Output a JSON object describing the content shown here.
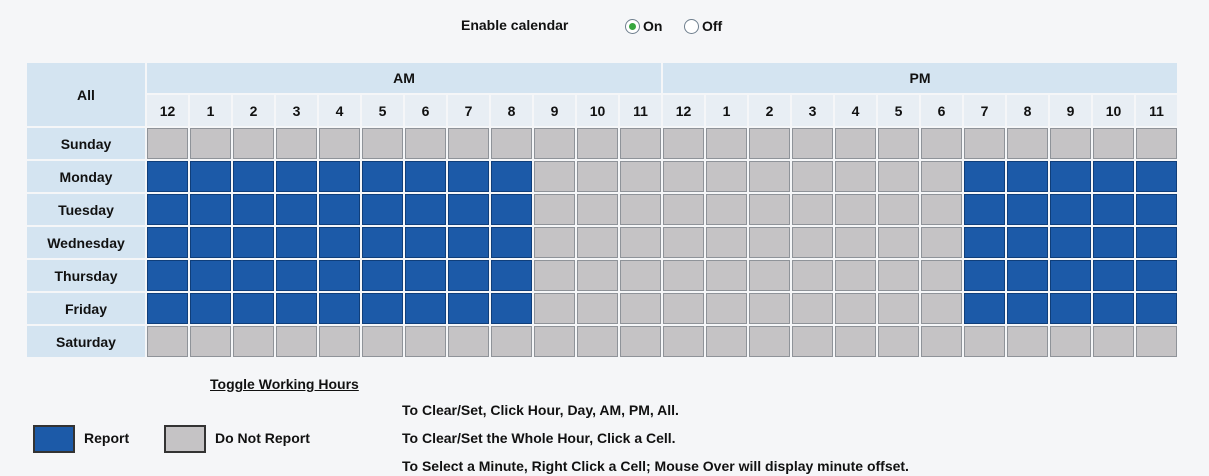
{
  "enable": {
    "label": "Enable calendar",
    "on_label": "On",
    "off_label": "Off",
    "selected": "On"
  },
  "calendar": {
    "all_label": "All",
    "am_label": "AM",
    "pm_label": "PM",
    "am_hours": [
      "12",
      "1",
      "2",
      "3",
      "4",
      "5",
      "6",
      "7",
      "8",
      "9",
      "10",
      "11"
    ],
    "pm_hours": [
      "12",
      "1",
      "2",
      "3",
      "4",
      "5",
      "6",
      "7",
      "8",
      "9",
      "10",
      "11"
    ],
    "days": [
      {
        "label": "Sunday",
        "slots": [
          0,
          0,
          0,
          0,
          0,
          0,
          0,
          0,
          0,
          0,
          0,
          0,
          0,
          0,
          0,
          0,
          0,
          0,
          0,
          0,
          0,
          0,
          0,
          0
        ]
      },
      {
        "label": "Monday",
        "slots": [
          1,
          1,
          1,
          1,
          1,
          1,
          1,
          1,
          1,
          0,
          0,
          0,
          0,
          0,
          0,
          0,
          0,
          0,
          0,
          1,
          1,
          1,
          1,
          1
        ]
      },
      {
        "label": "Tuesday",
        "slots": [
          1,
          1,
          1,
          1,
          1,
          1,
          1,
          1,
          1,
          0,
          0,
          0,
          0,
          0,
          0,
          0,
          0,
          0,
          0,
          1,
          1,
          1,
          1,
          1
        ]
      },
      {
        "label": "Wednesday",
        "slots": [
          1,
          1,
          1,
          1,
          1,
          1,
          1,
          1,
          1,
          0,
          0,
          0,
          0,
          0,
          0,
          0,
          0,
          0,
          0,
          1,
          1,
          1,
          1,
          1
        ]
      },
      {
        "label": "Thursday",
        "slots": [
          1,
          1,
          1,
          1,
          1,
          1,
          1,
          1,
          1,
          0,
          0,
          0,
          0,
          0,
          0,
          0,
          0,
          0,
          0,
          1,
          1,
          1,
          1,
          1
        ]
      },
      {
        "label": "Friday",
        "slots": [
          1,
          1,
          1,
          1,
          1,
          1,
          1,
          1,
          1,
          0,
          0,
          0,
          0,
          0,
          0,
          0,
          0,
          0,
          0,
          1,
          1,
          1,
          1,
          1
        ]
      },
      {
        "label": "Saturday",
        "slots": [
          0,
          0,
          0,
          0,
          0,
          0,
          0,
          0,
          0,
          0,
          0,
          0,
          0,
          0,
          0,
          0,
          0,
          0,
          0,
          0,
          0,
          0,
          0,
          0
        ]
      }
    ]
  },
  "footer": {
    "toggle_title": "Toggle Working Hours",
    "legend_report": "Report",
    "legend_no_report": "Do Not Report",
    "instructions": [
      "To Clear/Set, Click Hour, Day, AM, PM, All.",
      "To Clear/Set the Whole Hour, Click a Cell.",
      "To Select a Minute, Right Click a Cell; Mouse Over will display minute offset."
    ]
  },
  "colors": {
    "report": "#1c5aa8",
    "no_report": "#c5c3c5",
    "header": "#d4e4f1",
    "radio_dot": "#37a63e"
  }
}
